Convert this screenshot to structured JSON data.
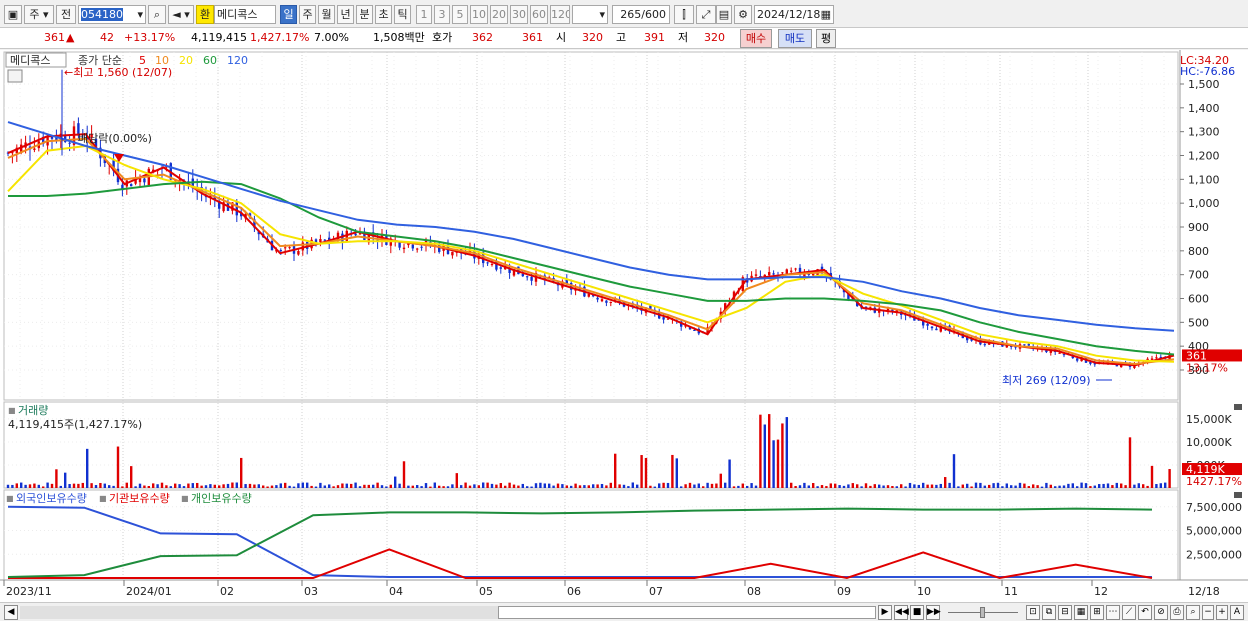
{
  "toolbar": {
    "kind_select": "주",
    "prev_label": "전",
    "code_value": "054180",
    "vol_label": "환",
    "name_value": "메디콕스",
    "periods": [
      "일",
      "주",
      "월",
      "년",
      "분",
      "초",
      "틱"
    ],
    "active_period": "일",
    "intervals": [
      "1",
      "3",
      "5",
      "10",
      "20",
      "30",
      "60",
      "120"
    ],
    "count_value": "265",
    "count_total": "/600",
    "date_value": "2024/12/18"
  },
  "infobar": {
    "price": "361",
    "change_arrow": "▲",
    "change": "42",
    "change_pct": "+13.17%",
    "volume": "4,119,415",
    "volume_pct": "1,427.17%",
    "turnover_pct": "7.00%",
    "amount": "1,508백만",
    "ask_label": "호가",
    "ask": "362",
    "bid": "361",
    "open_label": "시",
    "open": "320",
    "high_label": "고",
    "high": "391",
    "low_label": "저",
    "low": "320",
    "buy_label": "매수",
    "sell_label": "매도",
    "eval_label": "평"
  },
  "price_pane": {
    "name_label": "메디콕스",
    "legend": "종가 단순",
    "ma_periods": [
      "5",
      "10",
      "20",
      "60",
      "120"
    ],
    "ma_colors": [
      "#e00000",
      "#f08a1e",
      "#f6e400",
      "#1e9a3c",
      "#3060e0"
    ],
    "lc_label": "LC:34.20",
    "hc_label": "HC:-76.86",
    "high_note": "←최고 1,560 (12/07)",
    "low_note": "최저 269 (12/09)",
    "dividend_note": "배당락(0.00%)",
    "current_tag": "361",
    "current_pct": "13.17%",
    "y_ticks": [
      "1,500",
      "1,400",
      "1,300",
      "1,200",
      "1,100",
      "1,000",
      "900",
      "800",
      "700",
      "600",
      "500",
      "400",
      "300"
    ]
  },
  "volume_pane": {
    "title": "거래량",
    "value_label": "4,119,415주(1,427.17%)",
    "y_ticks": [
      "15,000K",
      "10,000K",
      "5,000K"
    ],
    "current_tag": "4,119K",
    "current_pct": "1427.17%"
  },
  "holding_pane": {
    "legends": [
      "외국인보유수량",
      "기관보유수량",
      "개인보유수량"
    ],
    "legend_colors": [
      "#2d52d8",
      "#e00000",
      "#1e8c3c"
    ],
    "y_ticks": [
      "7,500,000",
      "5,000,000",
      "2,500,000"
    ]
  },
  "x_axis": {
    "labels": [
      "2023/11",
      "2024/01",
      "02",
      "03",
      "04",
      "05",
      "06",
      "07",
      "08",
      "09",
      "10",
      "11",
      "12",
      "12/18"
    ]
  },
  "chart_data": {
    "type": "candlestick",
    "title": "메디콕스",
    "price_range": [
      269,
      1560
    ],
    "high_value": 1560,
    "high_date": "12/07",
    "low_value": 269,
    "low_date": "12/09",
    "last_close": 361,
    "ma_series": [
      {
        "name": "5",
        "values": [
          1210,
          1280,
          1290,
          1080,
          1150,
          1040,
          960,
          790,
          830,
          880,
          840,
          820,
          780,
          720,
          670,
          620,
          570,
          520,
          450,
          680,
          700,
          720,
          560,
          540,
          480,
          420,
          400,
          380,
          330,
          320,
          361
        ]
      },
      {
        "name": "10",
        "values": [
          1190,
          1260,
          1270,
          1100,
          1120,
          1050,
          980,
          820,
          830,
          860,
          840,
          820,
          790,
          730,
          680,
          630,
          580,
          530,
          470,
          640,
          700,
          710,
          580,
          550,
          490,
          430,
          400,
          390,
          340,
          325,
          345
        ]
      },
      {
        "name": "20",
        "values": [
          1050,
          1220,
          1240,
          1160,
          1100,
          1060,
          1000,
          870,
          830,
          840,
          840,
          830,
          800,
          750,
          700,
          650,
          600,
          550,
          500,
          560,
          670,
          700,
          620,
          570,
          510,
          450,
          420,
          400,
          360,
          340,
          335
        ]
      },
      {
        "name": "60",
        "values": [
          1030,
          1030,
          1040,
          1060,
          1080,
          1090,
          1080,
          1020,
          940,
          880,
          860,
          840,
          810,
          770,
          730,
          690,
          650,
          620,
          590,
          590,
          600,
          600,
          590,
          575,
          550,
          500,
          460,
          430,
          400,
          380,
          365
        ]
      },
      {
        "name": "120",
        "values": [
          1340,
          1290,
          1240,
          1200,
          1160,
          1110,
          1060,
          1010,
          970,
          930,
          910,
          900,
          880,
          850,
          810,
          770,
          730,
          700,
          680,
          680,
          690,
          690,
          670,
          630,
          600,
          560,
          530,
          510,
          490,
          475,
          465
        ]
      }
    ],
    "volume_max_k": 15000,
    "last_volume_k": 4119,
    "holding_series": [
      {
        "name": "외국인보유수량",
        "values": [
          7500000,
          7400000,
          4700000,
          4600000,
          300000,
          100000,
          100000,
          100000,
          100000,
          100000,
          100000,
          100000,
          100000,
          100000,
          100000,
          100000
        ]
      },
      {
        "name": "기관보유수량",
        "values": [
          0,
          0,
          0,
          0,
          0,
          3000000,
          0,
          0,
          0,
          0,
          1500000,
          0,
          2700000,
          0,
          1400000,
          0
        ]
      },
      {
        "name": "개인보유수량",
        "values": [
          100000,
          300000,
          2300000,
          2400000,
          6600000,
          6900000,
          6900000,
          6800000,
          6900000,
          7100000,
          7200000,
          7300000,
          7200000,
          7200000,
          7300000,
          7200000
        ]
      }
    ]
  }
}
